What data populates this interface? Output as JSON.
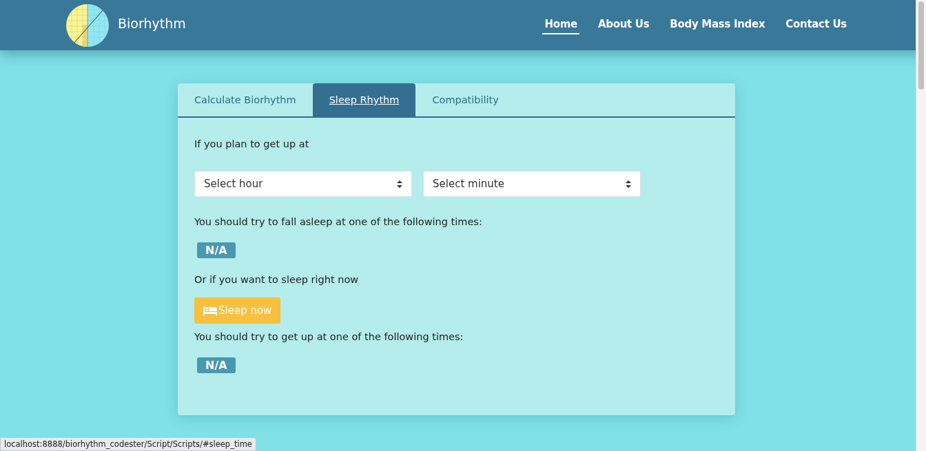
{
  "header": {
    "brand": "Biorhythm",
    "nav": [
      {
        "label": "Home",
        "selected": true
      },
      {
        "label": "About Us",
        "selected": false
      },
      {
        "label": "Body Mass Index",
        "selected": false
      },
      {
        "label": "Contact Us",
        "selected": false
      }
    ]
  },
  "tabs": [
    {
      "label": "Calculate Biorhythm",
      "selected": false
    },
    {
      "label": "Sleep Rhythm",
      "selected": true
    },
    {
      "label": "Compatibility",
      "selected": false
    }
  ],
  "sleep": {
    "intro": "If you plan to get up at",
    "selects": [
      {
        "placeholder": "Select hour"
      },
      {
        "placeholder": "Select minute"
      }
    ],
    "fall_asleep_text": "You should try to fall asleep at one of the following times:",
    "fall_asleep_result": "N/A",
    "sleep_now_text": "Or if you want to sleep right now",
    "sleep_now_button": "Sleep now",
    "wake_text": "You should try to get up at one of the following times:",
    "wake_result": "N/A"
  },
  "status_bar": "localhost:8888/biorhythm_codester/Script/Scripts/#sleep_time"
}
